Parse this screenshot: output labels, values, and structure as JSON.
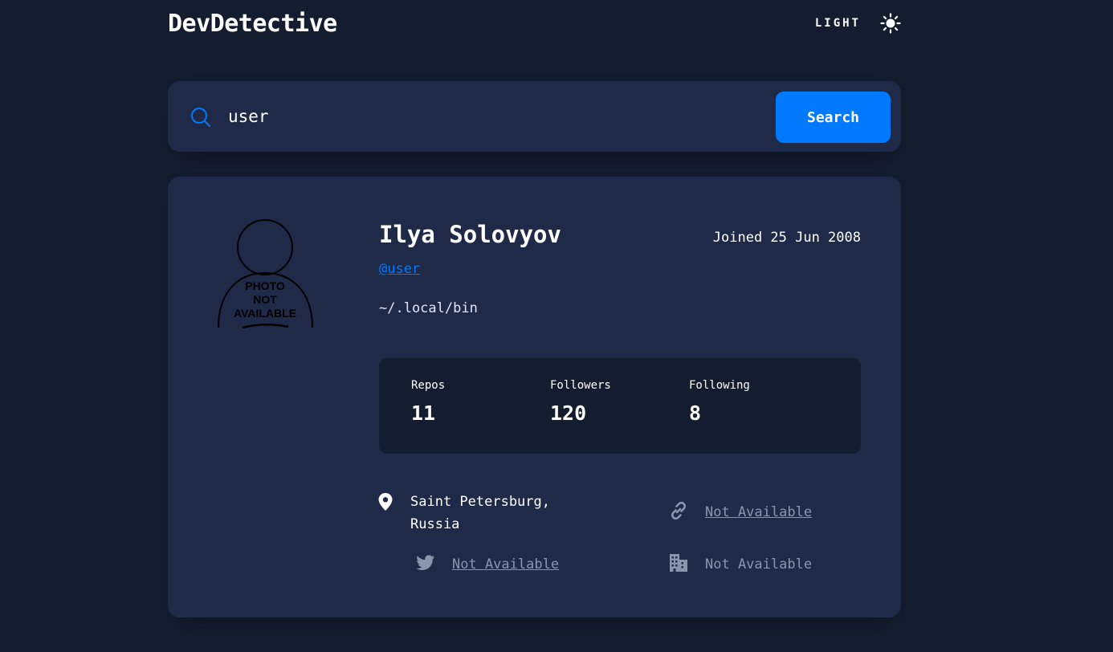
{
  "header": {
    "logo": "DevDetective",
    "theme_label": "LIGHT",
    "theme_icon": "sun-icon"
  },
  "search": {
    "value": "user",
    "button_label": "Search",
    "icon": "search-icon",
    "accent": "#0079ff"
  },
  "profile": {
    "avatar_text": [
      "PHOTO",
      "NOT",
      "AVAILABLE"
    ],
    "name": "Ilya Solovyov",
    "joined": "Joined 25 Jun 2008",
    "login": "@user",
    "bio": "~/.local/bin",
    "stats": {
      "repos_label": "Repos",
      "repos": "11",
      "followers_label": "Followers",
      "followers": "120",
      "following_label": "Following",
      "following": "8"
    },
    "links": {
      "location": "Saint Petersburg, Russia",
      "blog": "Not Available",
      "twitter": "Not Available",
      "company": "Not Available"
    }
  },
  "colors": {
    "background": "#141d2f",
    "card": "#1e2a47",
    "accent": "#0079ff",
    "muted": "#8b95ad"
  }
}
